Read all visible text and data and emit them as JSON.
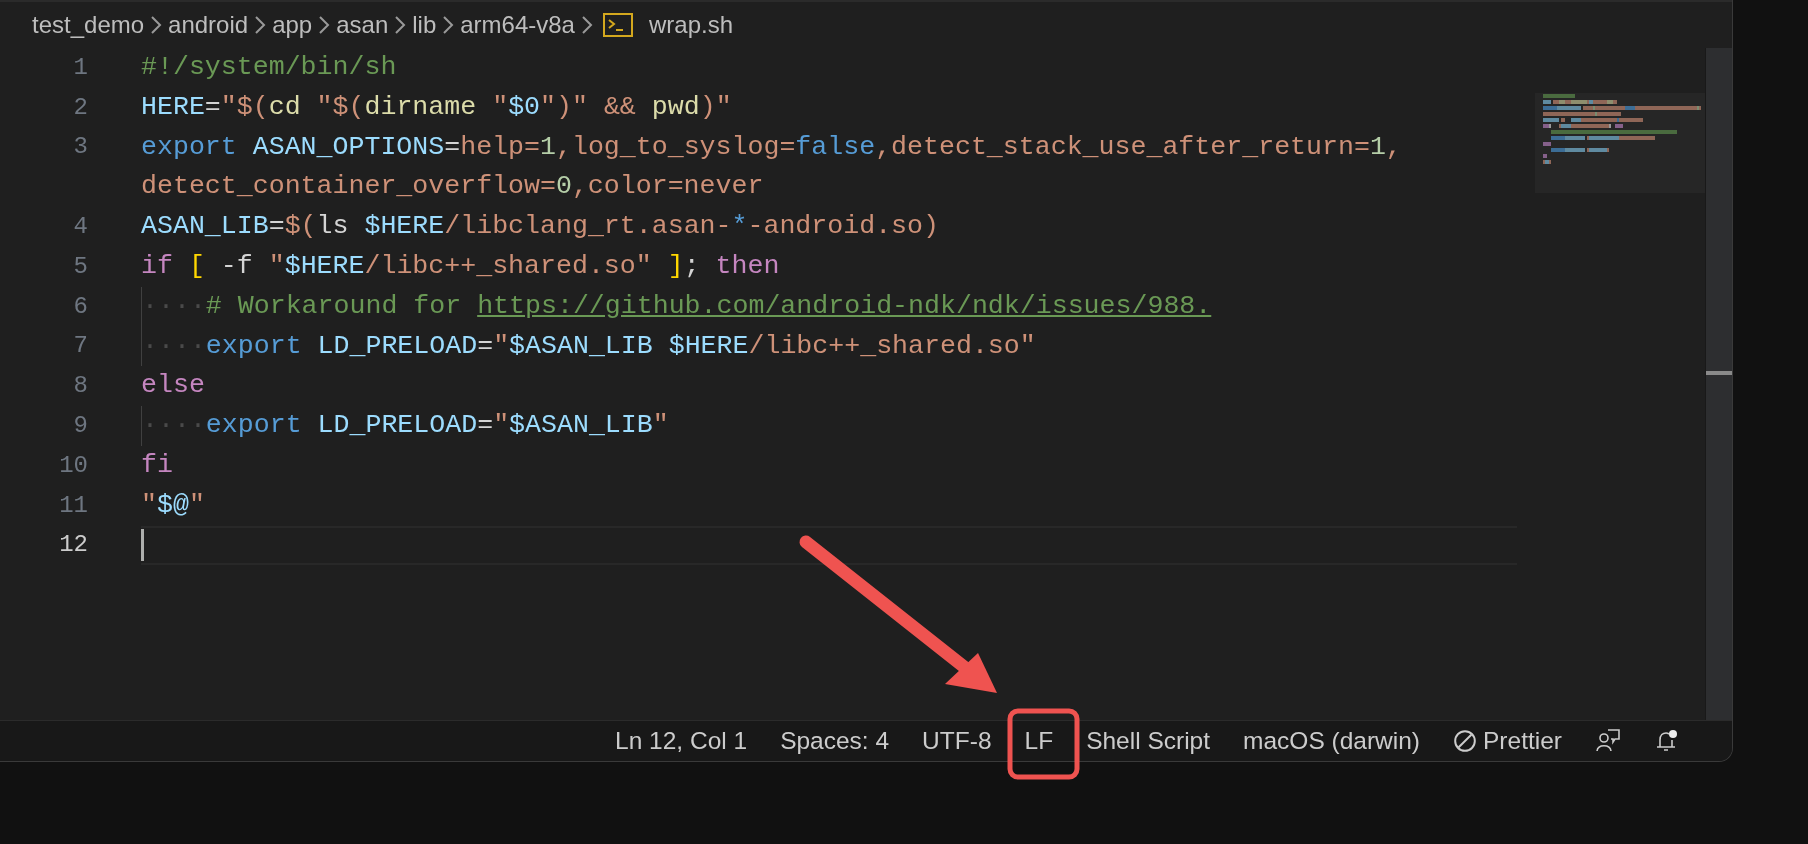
{
  "breadcrumb": [
    {
      "label": "test_demo",
      "kind": "folder"
    },
    {
      "label": "android",
      "kind": "folder"
    },
    {
      "label": "app",
      "kind": "folder"
    },
    {
      "label": "asan",
      "kind": "folder"
    },
    {
      "label": "lib",
      "kind": "folder"
    },
    {
      "label": "arm64-v8a",
      "kind": "folder"
    },
    {
      "label": "wrap.sh",
      "kind": "file"
    }
  ],
  "lines": [
    {
      "number": "1",
      "current": false,
      "tokens": [
        {
          "kind": "comment",
          "text": "#!/system/bin/sh"
        }
      ]
    },
    {
      "number": "2",
      "current": false,
      "tokens": [
        {
          "kind": "var",
          "text": "HERE"
        },
        {
          "kind": "plain",
          "text": "="
        },
        {
          "kind": "string",
          "text": "\"$("
        },
        {
          "kind": "func",
          "text": "cd "
        },
        {
          "kind": "string",
          "text": "\"$("
        },
        {
          "kind": "func",
          "text": "dirname "
        },
        {
          "kind": "string",
          "text": "\""
        },
        {
          "kind": "var",
          "text": "$0"
        },
        {
          "kind": "string",
          "text": "\")\" "
        },
        {
          "kind": "string",
          "text": "&& "
        },
        {
          "kind": "func",
          "text": "pwd"
        },
        {
          "kind": "string",
          "text": ")\""
        }
      ]
    },
    {
      "number": "3",
      "current": false,
      "tokens": [
        {
          "kind": "keyword",
          "text": "export "
        },
        {
          "kind": "var",
          "text": "ASAN_OPTIONS"
        },
        {
          "kind": "plain",
          "text": "="
        },
        {
          "kind": "string",
          "text": "help="
        },
        {
          "kind": "number",
          "text": "1"
        },
        {
          "kind": "string",
          "text": ",log_to_syslog="
        },
        {
          "kind": "keyword",
          "text": "false"
        },
        {
          "kind": "string",
          "text": ",detect_stack_use_after_return="
        },
        {
          "kind": "number",
          "text": "1"
        },
        {
          "kind": "string",
          "text": ","
        }
      ]
    },
    {
      "current": false,
      "tokens": [
        {
          "kind": "string",
          "text": "detect_container_overflow="
        },
        {
          "kind": "number",
          "text": "0"
        },
        {
          "kind": "string",
          "text": ",color=never"
        }
      ]
    },
    {
      "number": "4",
      "current": false,
      "tokens": [
        {
          "kind": "var",
          "text": "ASAN_LIB"
        },
        {
          "kind": "plain",
          "text": "="
        },
        {
          "kind": "string",
          "text": "$("
        },
        {
          "kind": "plain",
          "text": "ls "
        },
        {
          "kind": "var",
          "text": "$HERE"
        },
        {
          "kind": "string",
          "text": "/libclang_rt.asan-"
        },
        {
          "kind": "keyword",
          "text": "*"
        },
        {
          "kind": "string",
          "text": "-android.so)"
        }
      ]
    },
    {
      "number": "5",
      "current": false,
      "tokens": [
        {
          "kind": "control",
          "text": "if "
        },
        {
          "kind": "bracket",
          "text": "["
        },
        {
          "kind": "plain",
          "text": " -f "
        },
        {
          "kind": "string",
          "text": "\""
        },
        {
          "kind": "var",
          "text": "$HERE"
        },
        {
          "kind": "string",
          "text": "/libc++_shared.so\" "
        },
        {
          "kind": "bracket",
          "text": "]"
        },
        {
          "kind": "plain",
          "text": "; "
        },
        {
          "kind": "control",
          "text": "then"
        }
      ]
    },
    {
      "number": "6",
      "current": false,
      "tokens": [
        {
          "kind": "whitespace",
          "text": "····"
        },
        {
          "kind": "comment",
          "text": "# Workaround for "
        },
        {
          "kind": "link",
          "text": "https://github.com/android-ndk/ndk/issues/988."
        }
      ]
    },
    {
      "number": "7",
      "current": false,
      "tokens": [
        {
          "kind": "whitespace",
          "text": "····"
        },
        {
          "kind": "keyword",
          "text": "export "
        },
        {
          "kind": "var",
          "text": "LD_PRELOAD"
        },
        {
          "kind": "plain",
          "text": "="
        },
        {
          "kind": "string",
          "text": "\""
        },
        {
          "kind": "var",
          "text": "$ASAN_LIB $HERE"
        },
        {
          "kind": "string",
          "text": "/libc++_shared.so\""
        }
      ]
    },
    {
      "number": "8",
      "current": false,
      "tokens": [
        {
          "kind": "control",
          "text": "else"
        }
      ]
    },
    {
      "number": "9",
      "current": false,
      "tokens": [
        {
          "kind": "whitespace",
          "text": "····"
        },
        {
          "kind": "keyword",
          "text": "export "
        },
        {
          "kind": "var",
          "text": "LD_PRELOAD"
        },
        {
          "kind": "plain",
          "text": "="
        },
        {
          "kind": "string",
          "text": "\""
        },
        {
          "kind": "var",
          "text": "$ASAN_LIB"
        },
        {
          "kind": "string",
          "text": "\""
        }
      ]
    },
    {
      "number": "10",
      "current": false,
      "tokens": [
        {
          "kind": "control",
          "text": "fi"
        }
      ]
    },
    {
      "number": "11",
      "current": false,
      "tokens": [
        {
          "kind": "string",
          "text": "\""
        },
        {
          "kind": "var",
          "text": "$@"
        },
        {
          "kind": "string",
          "text": "\""
        }
      ]
    },
    {
      "number": "12",
      "current": true
    }
  ],
  "status_bar": [
    {
      "label": "Ln 12, Col 1",
      "kind": "text"
    },
    {
      "label": "Spaces: 4",
      "kind": "text"
    },
    {
      "label": "UTF-8",
      "kind": "text"
    },
    {
      "label": "LF",
      "kind": "text"
    },
    {
      "label": "Shell Script",
      "kind": "text"
    },
    {
      "label": "macOS (darwin)",
      "kind": "text"
    },
    {
      "label": "Prettier",
      "kind": "prettier"
    },
    {
      "kind": "feedback"
    },
    {
      "kind": "bell"
    }
  ]
}
